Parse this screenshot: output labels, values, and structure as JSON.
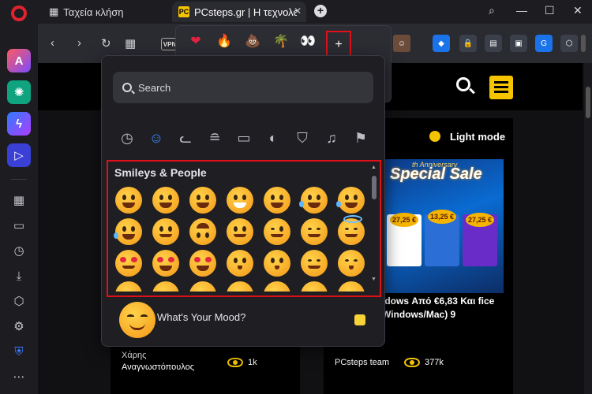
{
  "tabs": {
    "speed_dial": "Ταχεία κλήση",
    "active": "PCsteps.gr | Η τεχνολο",
    "active_favicon": "PC"
  },
  "toolbar": {
    "vpn": "VPN"
  },
  "quick_emojis": [
    "❤",
    "🔥",
    "💩",
    "🌴",
    "👀"
  ],
  "quick_plus": "+",
  "picker": {
    "search_placeholder": "Search",
    "section_title": "Smileys & People",
    "categories": [
      "recent-icon",
      "smiley-icon",
      "cat-icon",
      "burger-icon",
      "bus-icon",
      "ball-icon",
      "shirt-icon",
      "music-icon",
      "flag-icon"
    ],
    "mood_text": "What's Your Mood?"
  },
  "page": {
    "light_mode": "Light mode",
    "ad": {
      "title": "Special Sale",
      "subtitle": "th Anniversary",
      "prices": [
        "27,25 €",
        "13,25 €",
        "27,25 €"
      ]
    },
    "headline": "ndows Από €6,83 Και fice (Windows/Mac) 9",
    "author_left": "Χάρης Αναγνωστόπουλος",
    "views_left": "1k",
    "author_right": "PCsteps team",
    "views_right": "377k"
  }
}
